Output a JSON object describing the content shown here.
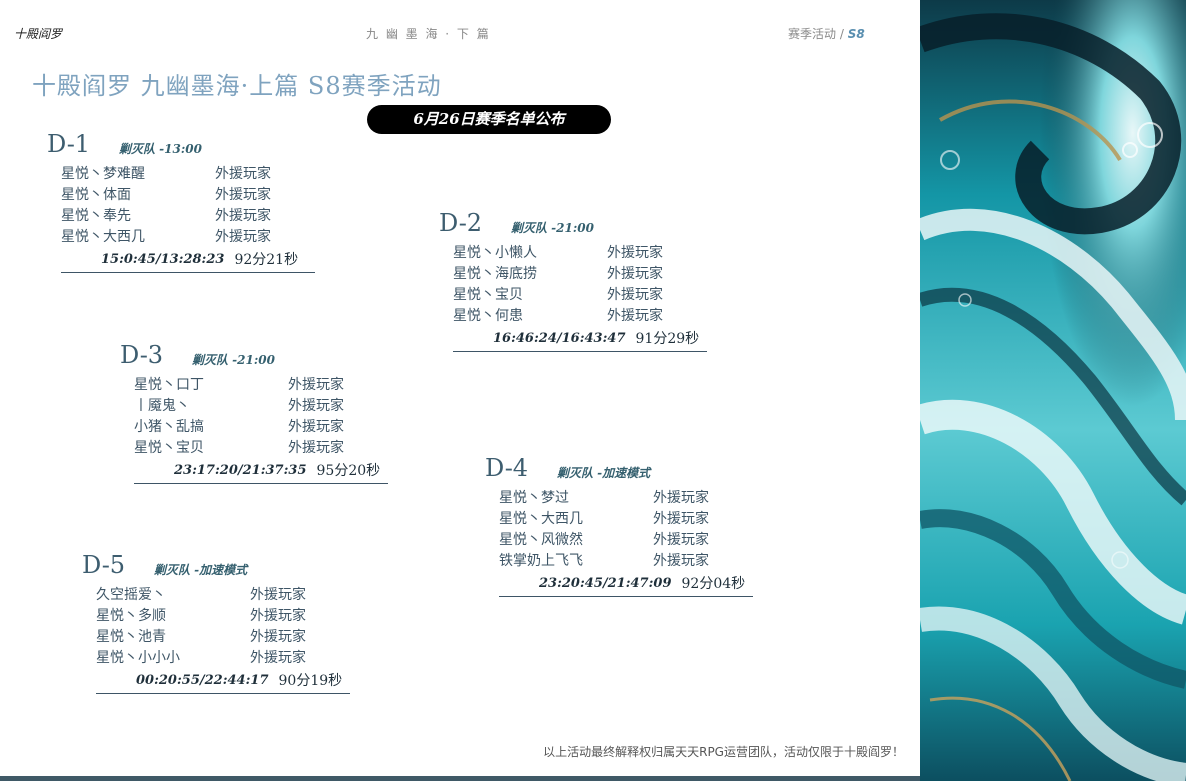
{
  "header": {
    "left_title": "十殿阎罗",
    "center_title": "九 幽 墨 海 · 下 篇",
    "right_prefix": "赛季活动 /",
    "right_season": "S8"
  },
  "main_title": "十殿阎罗  九幽墨海·上篇 S8赛季活动",
  "announcement": "6月26日赛季名单公布",
  "teams": [
    {
      "code": "D-1",
      "subtitle": "剿灭队 -13:00",
      "members": [
        {
          "player": "星悦丶梦难醒",
          "role": "外援玩家"
        },
        {
          "player": "星悦丶体面",
          "role": "外援玩家"
        },
        {
          "player": "星悦丶奉先",
          "role": "外援玩家"
        },
        {
          "player": "星悦丶大西几",
          "role": "外援玩家"
        }
      ],
      "time_range": "15:0:45/13:28:23",
      "duration": "92分21秒"
    },
    {
      "code": "D-2",
      "subtitle": "剿灭队 -21:00",
      "members": [
        {
          "player": "星悦丶小懒人",
          "role": "外援玩家"
        },
        {
          "player": "星悦丶海底捞",
          "role": "外援玩家"
        },
        {
          "player": "星悦丶宝贝",
          "role": "外援玩家"
        },
        {
          "player": "星悦丶何患",
          "role": "外援玩家"
        }
      ],
      "time_range": "16:46:24/16:43:47",
      "duration": "91分29秒"
    },
    {
      "code": "D-3",
      "subtitle": "剿灭队 -21:00",
      "members": [
        {
          "player": "星悦丶口丁",
          "role": "外援玩家"
        },
        {
          "player": "丨魇鬼丶",
          "role": "外援玩家"
        },
        {
          "player": "小猪丶乱搞",
          "role": "外援玩家"
        },
        {
          "player": "星悦丶宝贝",
          "role": "外援玩家"
        }
      ],
      "time_range": "23:17:20/21:37:35",
      "duration": "95分20秒"
    },
    {
      "code": "D-4",
      "subtitle": "剿灭队 -加速模式",
      "members": [
        {
          "player": "星悦丶梦过",
          "role": "外援玩家"
        },
        {
          "player": "星悦丶大西几",
          "role": "外援玩家"
        },
        {
          "player": "星悦丶风微然",
          "role": "外援玩家"
        },
        {
          "player": "铁掌奶上飞飞",
          "role": "外援玩家"
        }
      ],
      "time_range": "23:20:45/21:47:09",
      "duration": "92分04秒"
    },
    {
      "code": "D-5",
      "subtitle": "剿灭队 -加速模式",
      "members": [
        {
          "player": "久空摇爱丶",
          "role": "外援玩家"
        },
        {
          "player": "星悦丶多顺",
          "role": "外援玩家"
        },
        {
          "player": "星悦丶池青",
          "role": "外援玩家"
        },
        {
          "player": "星悦丶小小小",
          "role": "外援玩家"
        }
      ],
      "time_range": "00:20:55/22:44:17",
      "duration": "90分19秒"
    }
  ],
  "footer_note": "以上活动最终解释权归属天天RPG运营团队，活动仅限于十殿阎罗！",
  "colors": {
    "title": "#7fa3bf",
    "text": "#3e5566",
    "pill": "#000000",
    "bottom_bar": "#3f5966",
    "marble_teal": "#1aa3b0",
    "marble_dark": "#0b2b38"
  }
}
